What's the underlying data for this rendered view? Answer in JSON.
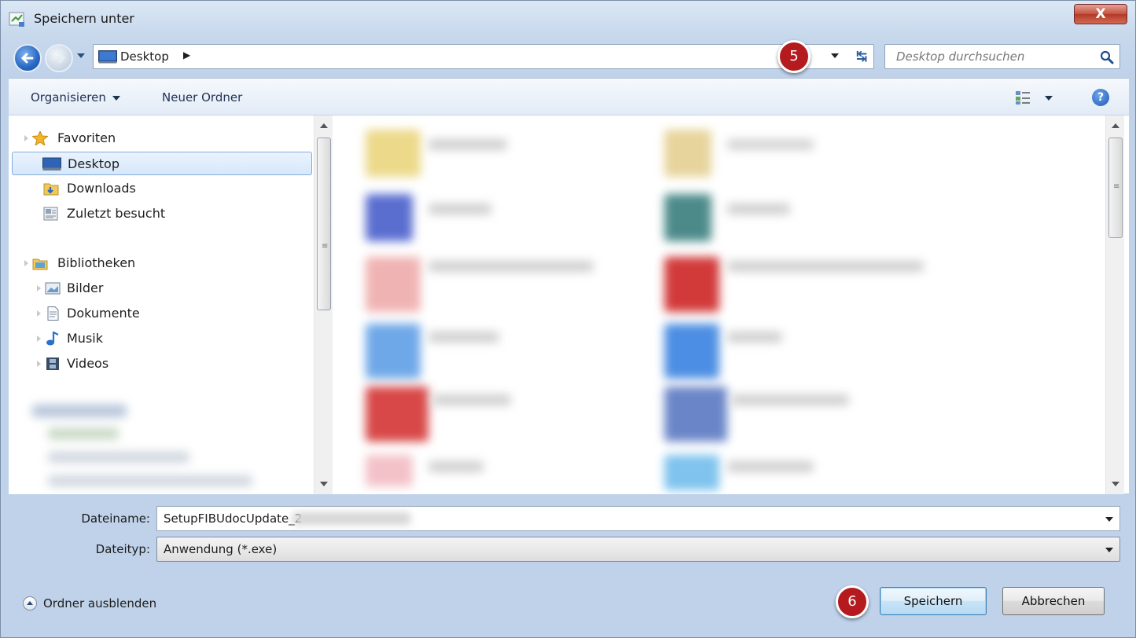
{
  "window": {
    "title": "Speichern unter",
    "close_label": "X"
  },
  "address": {
    "location": "Desktop",
    "search_placeholder": "Desktop durchsuchen"
  },
  "toolbar": {
    "organize_label": "Organisieren",
    "new_folder_label": "Neuer Ordner",
    "help_label": "?"
  },
  "nav": {
    "favorites_header": "Favoriten",
    "favorites": [
      "Desktop",
      "Downloads",
      "Zuletzt besucht"
    ],
    "libraries_header": "Bibliotheken",
    "libraries": [
      "Bilder",
      "Dokumente",
      "Musik",
      "Videos"
    ],
    "selected": "Desktop"
  },
  "form": {
    "filename_label": "Dateiname:",
    "filename_value": "SetupFIBUdocUpdate_2",
    "filetype_label": "Dateityp:",
    "filetype_value": "Anwendung (*.exe)"
  },
  "footer": {
    "hide_folders_label": "Ordner ausblenden",
    "save_label": "Speichern",
    "cancel_label": "Abbrechen"
  },
  "annotations": {
    "step_address": "5",
    "step_save": "6",
    "badge_color": "#b41a1e"
  },
  "icons": {
    "title": "save-as-icon",
    "back": "back-arrow-icon",
    "forward": "forward-arrow-icon",
    "refresh": "refresh-icon",
    "search": "search-icon",
    "view": "view-options-icon",
    "help": "help-icon"
  }
}
